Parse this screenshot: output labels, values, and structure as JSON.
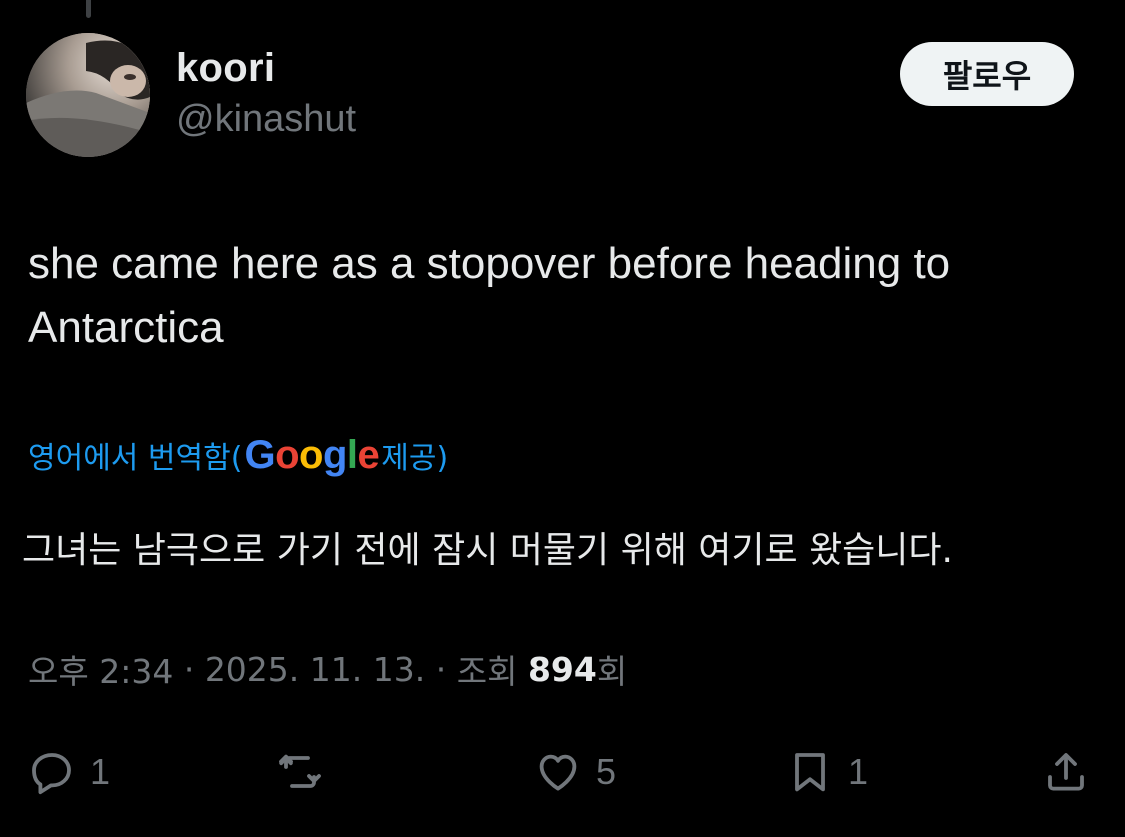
{
  "author": {
    "display_name": "koori",
    "handle": "@kinashut"
  },
  "follow_button": {
    "label": "팔로우"
  },
  "tweet": {
    "text": "she came here as a stopover before heading to Antarctica"
  },
  "translation": {
    "prefix": "영어에서 번역함(",
    "provider_letters": [
      {
        "char": "G",
        "color": "#4285F4"
      },
      {
        "char": "o",
        "color": "#EA4335"
      },
      {
        "char": "o",
        "color": "#FBBC05"
      },
      {
        "char": "g",
        "color": "#4285F4"
      },
      {
        "char": "l",
        "color": "#34A853"
      },
      {
        "char": "e",
        "color": "#EA4335"
      }
    ],
    "suffix": " 제공)",
    "text": "그녀는 남극으로 가기 전에 잠시 머물기 위해 여기로 왔습니다."
  },
  "meta": {
    "time": "오후 2:34",
    "separator": " · ",
    "date": "2025. 11. 13.",
    "views_label": "조회 ",
    "views_count": "894",
    "views_suffix": "회"
  },
  "actions": {
    "reply": {
      "icon": "reply-icon",
      "count": "1"
    },
    "repost": {
      "icon": "repost-icon",
      "count": ""
    },
    "like": {
      "icon": "heart-icon",
      "count": "5"
    },
    "bookmark": {
      "icon": "bookmark-icon",
      "count": "1"
    },
    "share": {
      "icon": "share-icon",
      "count": ""
    }
  },
  "colors": {
    "background": "#000000",
    "text_primary": "#e7e9ea",
    "text_secondary": "#71767b",
    "link": "#1d9bf0",
    "follow_button_bg": "#eff3f4"
  }
}
